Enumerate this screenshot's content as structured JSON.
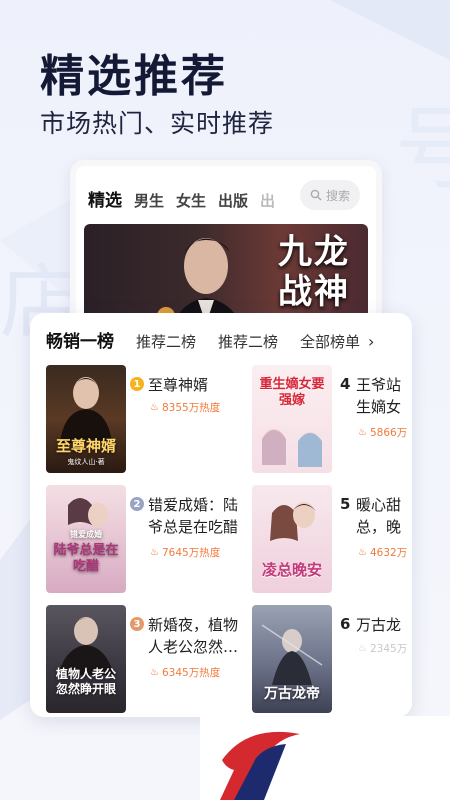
{
  "header": {
    "title": "精选推荐",
    "subtitle": "市场热门、实时推荐"
  },
  "phone": {
    "tabs": [
      "精选",
      "男生",
      "女生",
      "出版",
      "出"
    ],
    "search_placeholder": "搜索",
    "banner_title_line1": "九龙",
    "banner_title_line2": "战神"
  },
  "ranking": {
    "tabs": [
      "畅销一榜",
      "推荐二榜",
      "推荐二榜",
      "全部榜单"
    ],
    "more_icon": "chevron-right-icon",
    "books": [
      {
        "rank": "1",
        "title_line1": "至尊神婿",
        "title_line2": "",
        "heat": "8355万热度",
        "cover_text": "至尊神婿",
        "cover_sub": "鬼纹人山·著"
      },
      {
        "rank": "2",
        "title_line1": "错爱成婚：陆",
        "title_line2": "爷总是在吃醋",
        "heat": "7645万热度",
        "cover_text": "陆爷总是在吃醋",
        "cover_sub": "错爱成婚"
      },
      {
        "rank": "3",
        "title_line1": "新婚夜，植物",
        "title_line2": "人老公忽然…",
        "heat": "6345万热度",
        "cover_text": "植物人老公忽然睁开眼",
        "cover_sub": ""
      },
      {
        "rank": "4",
        "title_line1": "王爷站",
        "title_line2": "生嫡女",
        "heat": "5866万",
        "cover_text": "重生嫡女要强嫁",
        "cover_sub": ""
      },
      {
        "rank": "5",
        "title_line1": "暖心甜",
        "title_line2": "总，晚",
        "heat": "4632万",
        "cover_text": "凌总晚安",
        "cover_sub": ""
      },
      {
        "rank": "6",
        "title_line1": "万古龙",
        "title_line2": "",
        "heat": "2345万",
        "cover_text": "万古龙帝",
        "cover_sub": ""
      }
    ]
  },
  "colors": {
    "accent": "#f26b2a",
    "title": "#141a35",
    "logo_red": "#d42a2f",
    "logo_navy": "#1d2b6e"
  }
}
